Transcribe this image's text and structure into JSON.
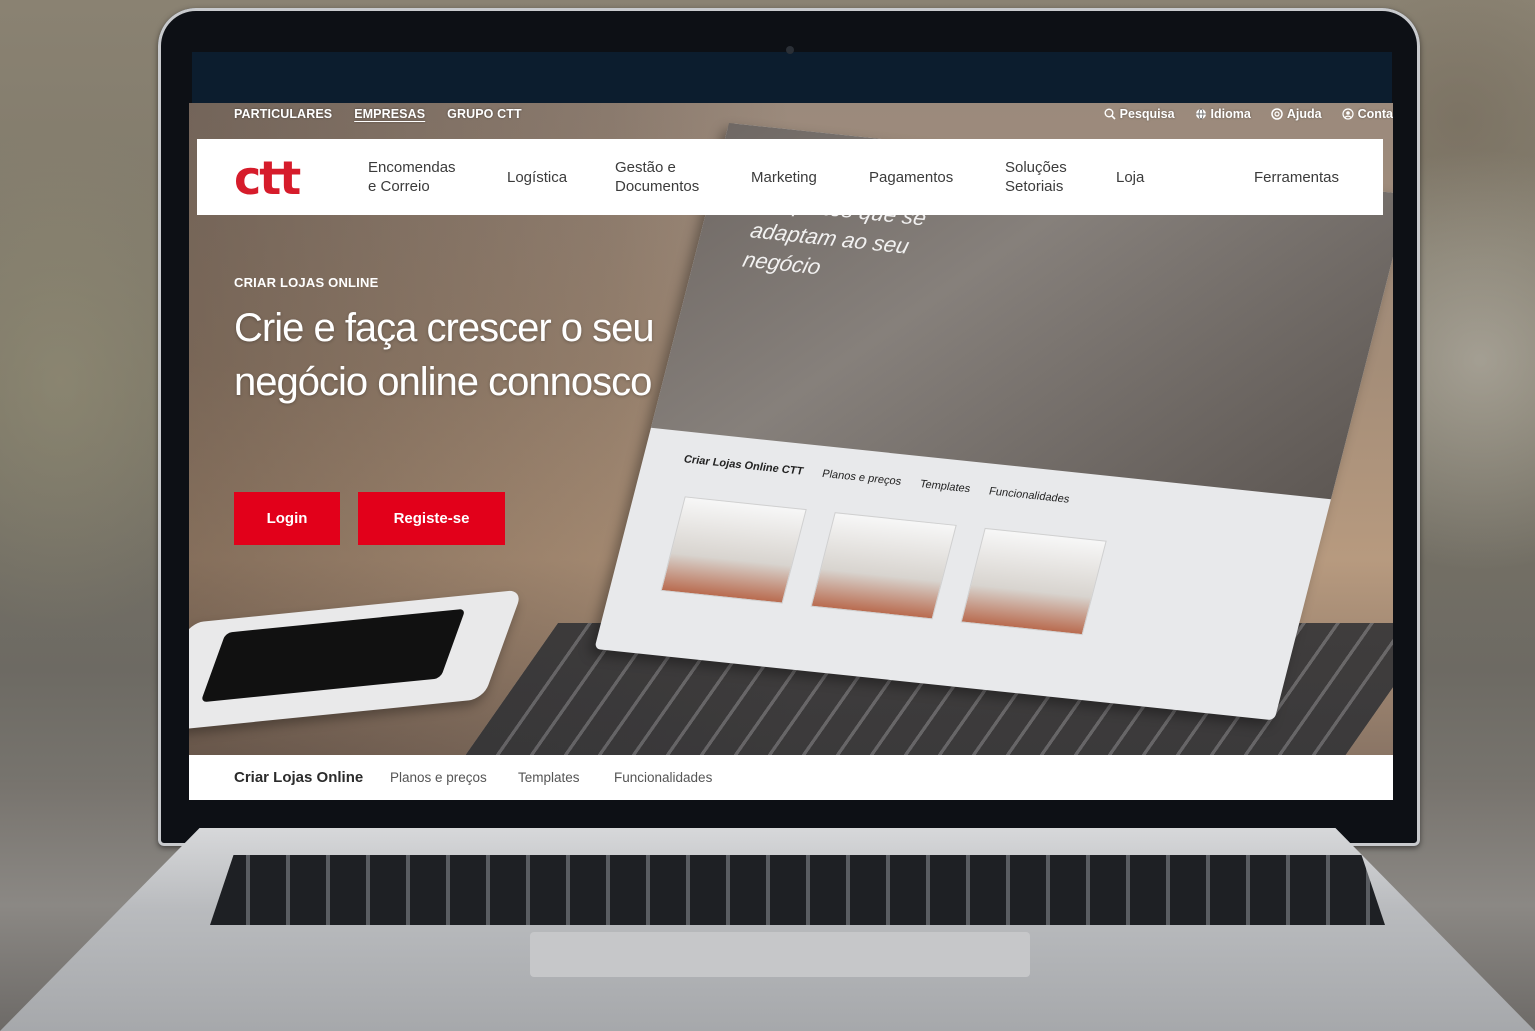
{
  "utility": {
    "segments": [
      "PARTICULARES",
      "EMPRESAS",
      "GRUPO CTT"
    ],
    "active_segment": "EMPRESAS",
    "links": [
      {
        "label": "Pesquisa",
        "icon": "search-icon"
      },
      {
        "label": "Idioma",
        "icon": "globe-icon"
      },
      {
        "label": "Ajuda",
        "icon": "help-icon"
      },
      {
        "label": "Conta",
        "icon": "account-icon"
      }
    ]
  },
  "brand": {
    "logo_text": "ctt",
    "color": "#d61c2b"
  },
  "nav": {
    "items": [
      {
        "label": "Encomendas e Correio"
      },
      {
        "label": "Logística"
      },
      {
        "label": "Gestão e Documentos"
      },
      {
        "label": "Marketing"
      },
      {
        "label": "Pagamentos"
      },
      {
        "label": "Soluções Setoriais"
      },
      {
        "label": "Loja"
      },
      {
        "label": "Ferramentas"
      }
    ]
  },
  "hero": {
    "kicker": "CRIAR LOJAS ONLINE",
    "headline": "Crie e faça crescer o seu negócio online connosco",
    "login_label": "Login",
    "register_label": "Registe-se",
    "button_color": "#e2001a",
    "mock_text": "templates que se adaptam ao seu negócio",
    "mock_tabs": [
      "Criar Lojas Online CTT",
      "Planos e preços",
      "Templates",
      "Funcionalidades"
    ]
  },
  "subnav": {
    "items": [
      {
        "label": "Criar Lojas Online",
        "current": true
      },
      {
        "label": "Planos e preços",
        "current": false
      },
      {
        "label": "Templates",
        "current": false
      },
      {
        "label": "Funcionalidades",
        "current": false
      }
    ]
  }
}
